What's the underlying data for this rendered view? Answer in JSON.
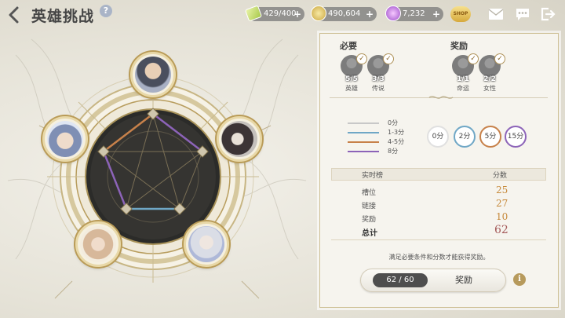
{
  "header": {
    "title": "英雄挑战",
    "help_label": "?",
    "resources": [
      {
        "name": "stamina",
        "value": "429/400",
        "icon": "stamina-crystal-icon",
        "plus": "+"
      },
      {
        "name": "gold",
        "value": "490,604",
        "icon": "gold-coin-icon",
        "plus": "+"
      },
      {
        "name": "gem",
        "value": "7,232",
        "icon": "gem-icon",
        "plus": "+"
      }
    ],
    "shop_label": "SHOP"
  },
  "panel": {
    "required": {
      "label": "必要",
      "slots": [
        {
          "count": "5/5",
          "label": "英雄",
          "checked": true
        },
        {
          "count": "3/3",
          "label": "传说",
          "checked": true
        }
      ]
    },
    "reward": {
      "label": "奖励",
      "slots": [
        {
          "count": "1/1",
          "label": "命运",
          "checked": true
        },
        {
          "count": "2/2",
          "label": "女性",
          "checked": true
        }
      ]
    },
    "legend": [
      {
        "label": "0分",
        "color": "#c8c8c8"
      },
      {
        "label": "1-3分",
        "color": "#6fa7c6"
      },
      {
        "label": "4-5分",
        "color": "#c7814a"
      },
      {
        "label": "8分",
        "color": "#8c63b8"
      }
    ],
    "badges": [
      {
        "label": "0分",
        "color": "#e0e0e0"
      },
      {
        "label": "2分",
        "color": "#6fa7c6"
      },
      {
        "label": "5分",
        "color": "#c7814a"
      },
      {
        "label": "15分",
        "color": "#8c63b8"
      }
    ],
    "ranking": {
      "header_left": "实时榜",
      "header_right": "分数",
      "rows": [
        {
          "label": "槽位",
          "value": "25"
        },
        {
          "label": "链接",
          "value": "27"
        },
        {
          "label": "奖励",
          "value": "10"
        }
      ],
      "total_label": "总计",
      "total_value": "62"
    },
    "hint": "满足必要条件和分数才能获得奖励。",
    "progress": "62 / 60",
    "reward_button": "奖励",
    "info_label": "i"
  }
}
